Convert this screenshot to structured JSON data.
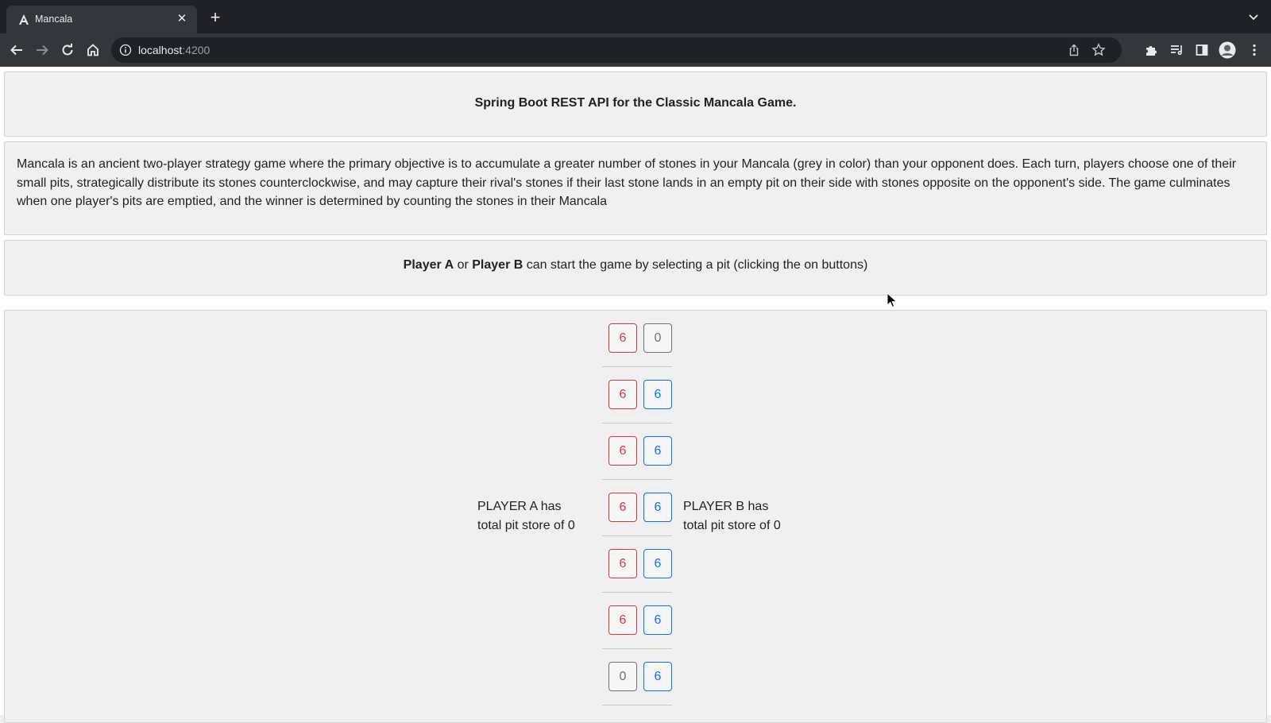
{
  "browser": {
    "tab_title": "Mancala",
    "url_host": "localhost",
    "url_port": ":4200"
  },
  "header": {
    "title": "Spring Boot REST API for the Classic Mancala Game."
  },
  "description": {
    "text": "Mancala is an ancient two-player strategy game where the primary objective is to accumulate a greater number of stones in your Mancala (grey in color) than your opponent does. Each turn, players choose one of their small pits, strategically distribute its stones counterclockwise, and may capture their rival's stones if their last stone lands in an empty pit on their side with stones opposite on the opponent's side. The game culminates when one player's pits are emptied, and the winner is determined by counting the stones in their Mancala"
  },
  "instructions": {
    "player_a": "Player A",
    "or": " or ",
    "player_b": "Player B",
    "rest": " can start the game by selecting a pit (clicking the on buttons)"
  },
  "board": {
    "rows": [
      {
        "left": {
          "value": "6",
          "color": "red"
        },
        "right": {
          "value": "0",
          "color": "grey"
        }
      },
      {
        "left": {
          "value": "6",
          "color": "red"
        },
        "right": {
          "value": "6",
          "color": "blue"
        }
      },
      {
        "left": {
          "value": "6",
          "color": "red"
        },
        "right": {
          "value": "6",
          "color": "blue"
        }
      },
      {
        "left": {
          "value": "6",
          "color": "red"
        },
        "right": {
          "value": "6",
          "color": "blue"
        }
      },
      {
        "left": {
          "value": "6",
          "color": "red"
        },
        "right": {
          "value": "6",
          "color": "blue"
        }
      },
      {
        "left": {
          "value": "6",
          "color": "red"
        },
        "right": {
          "value": "6",
          "color": "blue"
        }
      },
      {
        "left": {
          "value": "0",
          "color": "grey"
        },
        "right": {
          "value": "6",
          "color": "blue"
        }
      }
    ],
    "player_a": {
      "line1": "PLAYER A has",
      "line2": "total pit store of 0"
    },
    "player_b": {
      "line1": "PLAYER B has",
      "line2": "total pit store of 0"
    }
  },
  "colors": {
    "red": "#dc3545",
    "blue": "#0d6efd",
    "grey": "#6c757d"
  },
  "icons": [
    "angular-favicon-icon",
    "close-icon",
    "plus-icon",
    "chevron-down-icon",
    "back-arrow-icon",
    "forward-arrow-icon",
    "reload-icon",
    "home-icon",
    "info-icon",
    "share-icon",
    "star-icon",
    "puzzle-extension-icon",
    "reading-list-icon",
    "side-panel-icon",
    "profile-avatar-icon",
    "kebab-menu-icon",
    "mouse-cursor-icon"
  ]
}
